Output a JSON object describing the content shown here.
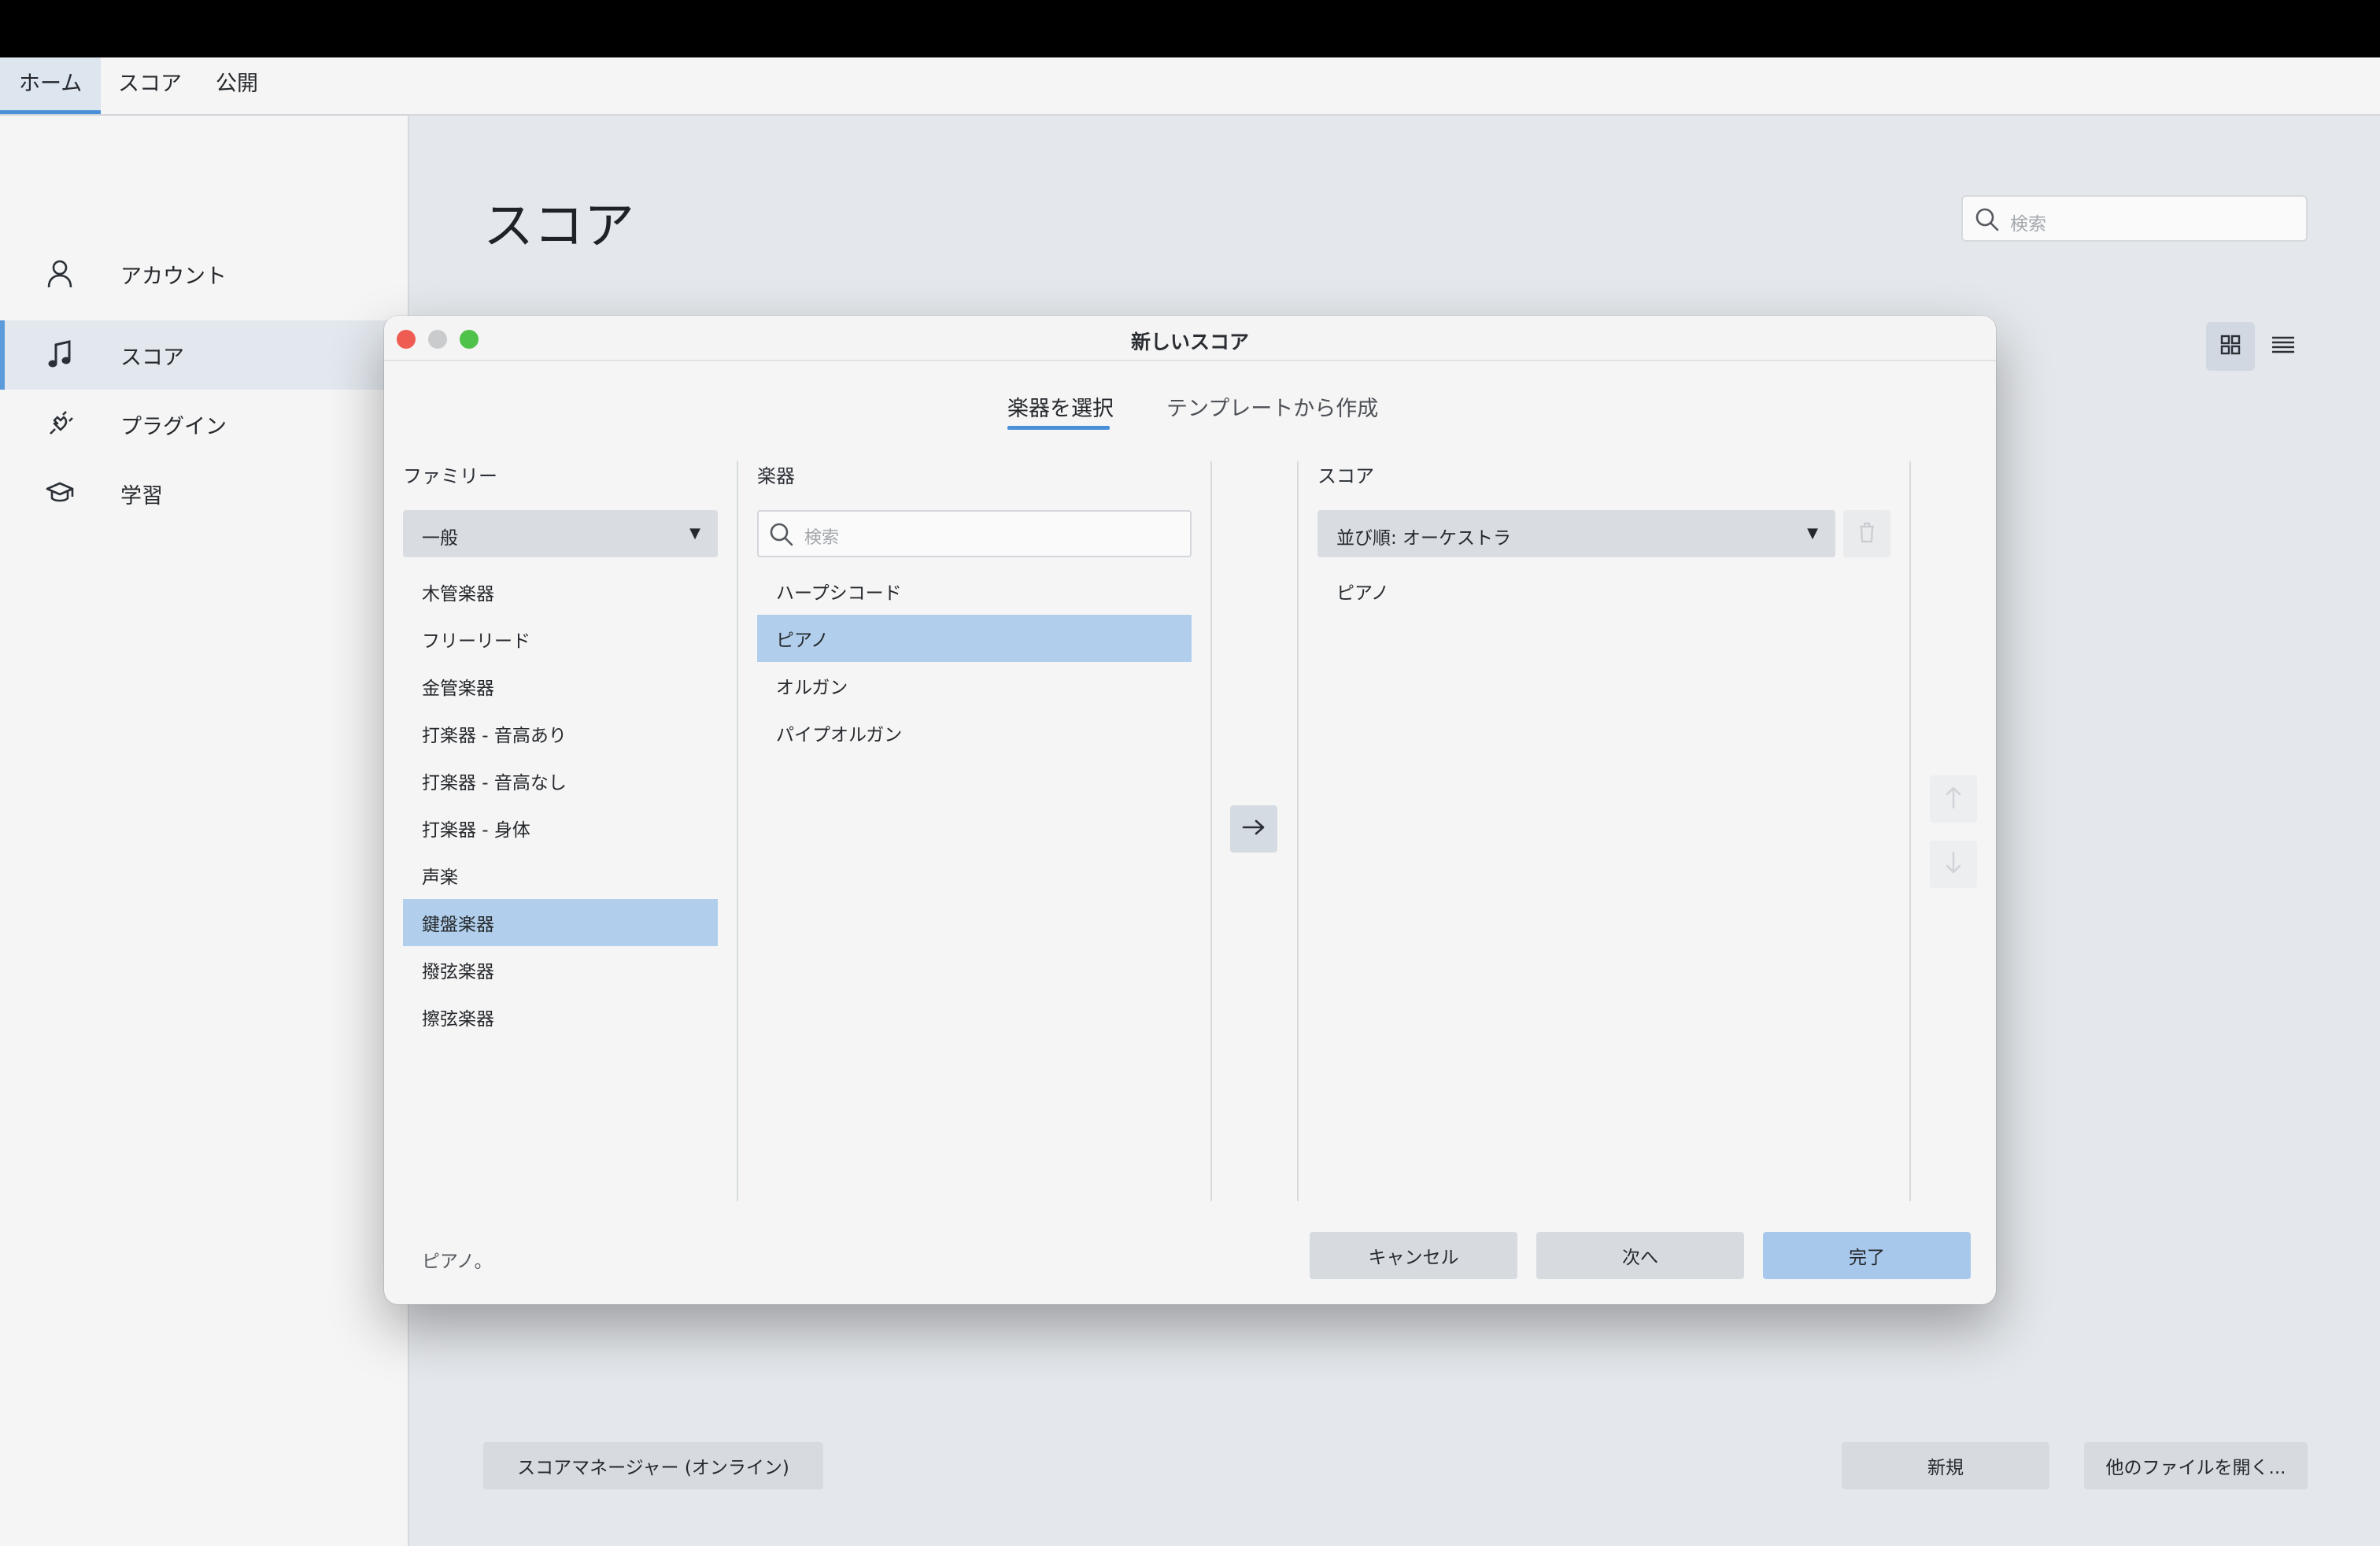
{
  "menubar": {
    "tabs": [
      {
        "label": "ホーム",
        "active": true
      },
      {
        "label": "スコア",
        "active": false
      },
      {
        "label": "公開",
        "active": false
      }
    ]
  },
  "sidebar": {
    "items": [
      {
        "label": "アカウント",
        "icon": "account-icon",
        "active": false
      },
      {
        "label": "スコア",
        "icon": "music-note-icon",
        "active": true
      },
      {
        "label": "プラグイン",
        "icon": "plugin-icon",
        "active": false
      },
      {
        "label": "学習",
        "icon": "graduation-cap-icon",
        "active": false
      }
    ]
  },
  "main": {
    "title": "スコア",
    "search_placeholder": "検索",
    "bottom": {
      "score_manager": "スコアマネージャー (オンライン)",
      "new": "新規",
      "open_other": "他のファイルを開く..."
    }
  },
  "dialog": {
    "title": "新しいスコア",
    "tabs": [
      "楽器を選択",
      "テンプレートから作成"
    ],
    "family": {
      "label": "ファミリー",
      "selected": "一般",
      "items": [
        "木管楽器",
        "フリーリード",
        "金管楽器",
        "打楽器 - 音高あり",
        "打楽器 - 音高なし",
        "打楽器 - 身体",
        "声楽",
        "鍵盤楽器",
        "撥弦楽器",
        "擦弦楽器"
      ],
      "selected_index": 7
    },
    "instruments": {
      "label": "楽器",
      "search_placeholder": "検索",
      "items": [
        "ハープシコード",
        "ピアノ",
        "オルガン",
        "パイプオルガン"
      ],
      "selected_index": 1
    },
    "score": {
      "label": "スコア",
      "order": "並び順: オーケストラ",
      "items": [
        "ピアノ"
      ]
    },
    "status": "ピアノ。",
    "buttons": {
      "cancel": "キャンセル",
      "next": "次へ",
      "done": "完了"
    }
  },
  "colors": {
    "accent": "#4a90d9",
    "selection": "#b1cfec",
    "primary_button": "#a7c8ea"
  }
}
